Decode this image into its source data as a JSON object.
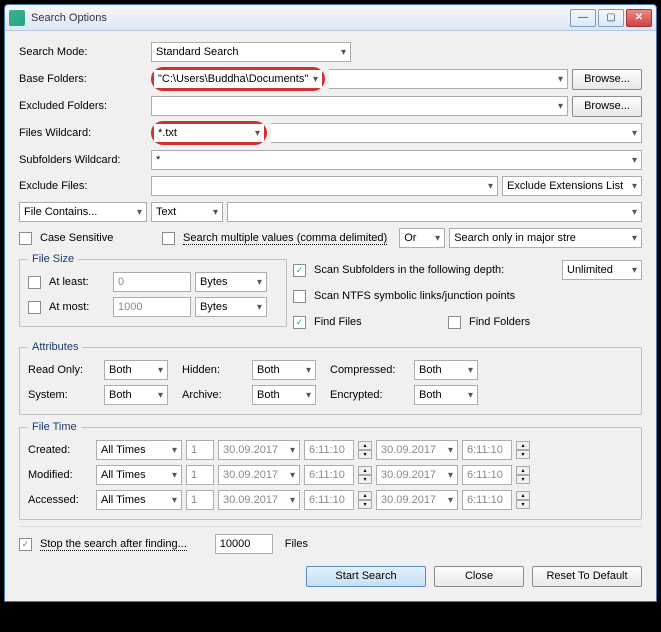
{
  "window": {
    "title": "Search Options"
  },
  "labels": {
    "search_mode": "Search Mode:",
    "base_folders": "Base Folders:",
    "excluded_folders": "Excluded Folders:",
    "files_wildcard": "Files Wildcard:",
    "subfolders_wildcard": "Subfolders Wildcard:",
    "exclude_files": "Exclude Files:",
    "case_sensitive": "Case Sensitive",
    "search_multiple": "Search multiple values (comma delimited)",
    "or": "Or",
    "search_major": "Search only in major stre",
    "file_size": "File Size",
    "at_least": "At least:",
    "at_most": "At most:",
    "scan_subfolders": "Scan Subfolders in the following depth:",
    "scan_ntfs": "Scan NTFS symbolic links/junction points",
    "find_files": "Find Files",
    "find_folders": "Find Folders",
    "attributes": "Attributes",
    "read_only": "Read Only:",
    "hidden": "Hidden:",
    "compressed": "Compressed:",
    "system": "System:",
    "archive": "Archive:",
    "encrypted": "Encrypted:",
    "file_time": "File Time",
    "created": "Created:",
    "modified": "Modified:",
    "accessed": "Accessed:",
    "stop_after": "Stop the search after finding...",
    "files": "Files",
    "browse": "Browse...",
    "exclude_ext_list": "Exclude Extensions List",
    "start_search": "Start Search",
    "close": "Close",
    "reset": "Reset To Default"
  },
  "values": {
    "search_mode": "Standard Search",
    "base_folders": "\"C:\\Users\\Buddha\\Documents\"",
    "excluded_folders": "",
    "files_wildcard": "*.txt",
    "subfolders_wildcard": "*",
    "exclude_files": "",
    "file_contains": "File Contains...",
    "contains_type": "Text",
    "contains_value": "",
    "at_least_val": "0",
    "at_most_val": "1000",
    "bytes": "Bytes",
    "unlimited": "Unlimited",
    "both": "Both",
    "all_times": "All Times",
    "num1": "1",
    "date": "30.09.2017",
    "time": "6:11:10",
    "stop_count": "10000"
  },
  "checks": {
    "case_sensitive": false,
    "search_multiple": false,
    "at_least": false,
    "at_most": false,
    "scan_subfolders": true,
    "scan_ntfs": false,
    "find_files": true,
    "find_folders": false,
    "stop_after": true
  }
}
